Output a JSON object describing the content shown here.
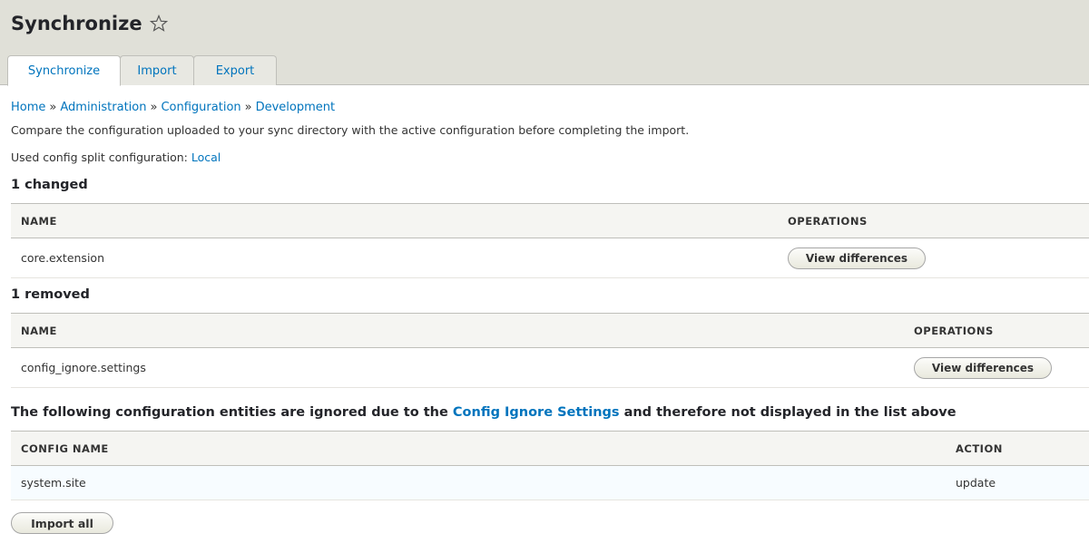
{
  "header": {
    "title": "Synchronize",
    "tabs": [
      {
        "label": "Synchronize",
        "active": true
      },
      {
        "label": "Import",
        "active": false
      },
      {
        "label": "Export",
        "active": false
      }
    ]
  },
  "breadcrumb": [
    "Home",
    "Administration",
    "Configuration",
    "Development"
  ],
  "breadcrumb_separator": "»",
  "intro": "Compare the configuration uploaded to your sync directory with the active configuration before completing the import.",
  "split": {
    "prefix": "Used config split configuration: ",
    "link": "Local"
  },
  "changed": {
    "heading": "1 changed",
    "columns": [
      "NAME",
      "OPERATIONS"
    ],
    "rows": [
      {
        "name": "core.extension",
        "button": "View differences"
      }
    ]
  },
  "removed": {
    "heading": "1 removed",
    "columns": [
      "NAME",
      "OPERATIONS"
    ],
    "rows": [
      {
        "name": "config_ignore.settings",
        "button": "View differences"
      }
    ]
  },
  "ignored": {
    "heading_prefix": "The following configuration entities are ignored due to the ",
    "heading_link": "Config Ignore Settings",
    "heading_suffix": " and therefore not displayed in the list above",
    "columns": [
      "CONFIG NAME",
      "ACTION"
    ],
    "rows": [
      {
        "name": "system.site",
        "action": "update"
      }
    ]
  },
  "import_all_label": "Import all",
  "colors": {
    "header_bg": "#e0e0d8",
    "link": "#0074bd",
    "table_header_bg": "#f5f5f2"
  }
}
